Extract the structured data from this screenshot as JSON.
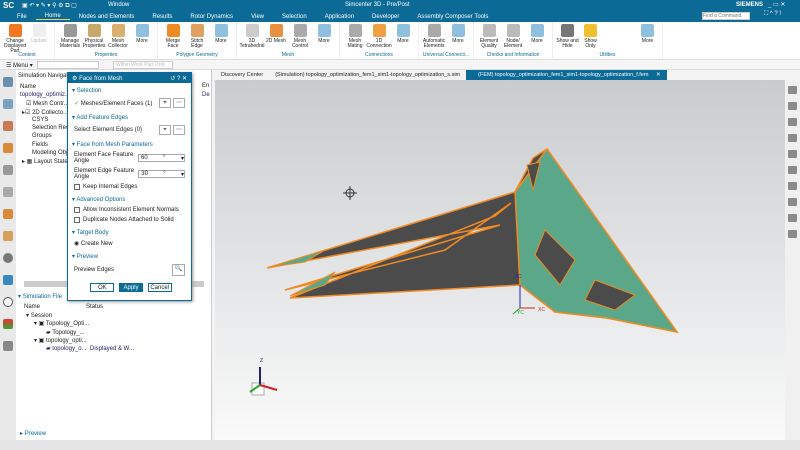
{
  "title": {
    "app": "SC",
    "window_menu": "Window",
    "text": "Simcenter 3D - Pre/Post",
    "brand": "SIEMENS",
    "search_placeholder": "Find a Command"
  },
  "menu": [
    "File",
    "Home",
    "Nodes and Elements",
    "Results",
    "Rotor Dynamics",
    "View",
    "Selection",
    "Application",
    "Developer",
    "Assembly Composer Tools"
  ],
  "ribbon": [
    {
      "label": "Context",
      "buttons": [
        "Change Displayed Part",
        "Update"
      ]
    },
    {
      "label": "Properties",
      "buttons": [
        "Manage Materials",
        "Physical Properties",
        "Mesh Collector",
        "More"
      ]
    },
    {
      "label": "Polygon Geometry",
      "buttons": [
        "Merge Face",
        "Stitch Edge",
        "More"
      ]
    },
    {
      "label": "Mesh",
      "buttons": [
        "3D Tetrahedral",
        "2D Mesh",
        "Mesh Control",
        "More"
      ]
    },
    {
      "label": "Connections",
      "buttons": [
        "Mesh Mating",
        "1D Connection",
        "More"
      ]
    },
    {
      "label": "Universal Connecti...",
      "buttons": [
        "Automatic Elements",
        "More"
      ]
    },
    {
      "label": "Checks and Information",
      "buttons": [
        "Element Quality",
        "Node/ Element",
        "More"
      ]
    },
    {
      "label": "Utilities",
      "buttons": [
        "Show and Hide",
        "Show Only",
        "More"
      ]
    }
  ],
  "cmdbar": {
    "menu": "Menu",
    "filter": "Within Work Part Only"
  },
  "nav": {
    "title": "Simulation Navigator",
    "col_name": "Name",
    "tree": [
      "topology_optimiz...",
      "Mesh Contr...",
      "2D Collecto...",
      "CSYS",
      "Selection Recip...",
      "Groups",
      "Fields",
      "Modeling Obje...",
      "Layout States"
    ],
    "file_title": "Simulation File",
    "file_cols": [
      "Name",
      "Status"
    ],
    "file_tree": [
      "Session",
      "Topology_Opti...",
      "Topology_...",
      "topology_opti...",
      "topology_o..."
    ],
    "file_status": "Displayed & W...",
    "preview": "Preview"
  },
  "dialog": {
    "title": "Face from Mesh",
    "selection": "Selection",
    "meshes": "Meshes/Element Faces (1)",
    "add_edges": "Add Feature Edges",
    "select_edges": "Select Element Edges (0)",
    "params": "Face from Mesh Parameters",
    "face_angle_label": "Element Face Feature Angle",
    "face_angle": "60",
    "edge_angle_label": "Element Edge Feature Angle",
    "edge_angle": "30",
    "unit": "°",
    "keep_internal": "Keep Internal Edges",
    "advanced": "Advanced Options",
    "allow_normals": "Allow Inconsistent Element Normals",
    "duplicate_nodes": "Duplicate Nodes Attached to Solid",
    "target": "Target Body",
    "create_new": "Create New",
    "preview": "Preview",
    "preview_edges": "Preview Edges",
    "ok": "OK",
    "apply": "Apply",
    "cancel": "Cancel"
  },
  "tabs": [
    "Discovery Center",
    "(Simulation) topology_optimization_fem1_sim1-topology_optimization_s.sim",
    "(FEM) topology_optimization_fem1_sim1-topology_optimization_f.fem"
  ],
  "side_partial": [
    "En",
    "De"
  ],
  "triad": {
    "zc": "ZC",
    "yc": "YC",
    "xc": "XC",
    "z": "Z"
  },
  "colors": {
    "accent": "#0b6a96",
    "mesh": "#5aa889",
    "outline": "#f08a24",
    "body": "#4b4b4b"
  }
}
